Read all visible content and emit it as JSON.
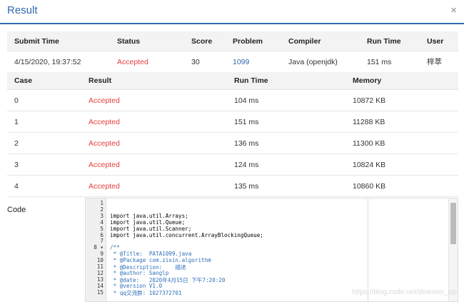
{
  "dialog": {
    "title": "Result",
    "close_icon": "×"
  },
  "submission": {
    "headers": [
      "Submit Time",
      "Status",
      "Score",
      "Problem",
      "Compiler",
      "Run Time",
      "User"
    ],
    "row": {
      "submit_time": "4/15/2020, 19:37:52",
      "status": "Accepted",
      "score": "30",
      "problem": "1099",
      "compiler": "Java (openjdk)",
      "run_time": "151 ms",
      "user": "梓萃"
    },
    "colors": {
      "accepted": "#e53e3e",
      "link": "#2f6ab0"
    }
  },
  "cases": {
    "headers": [
      "Case",
      "Result",
      "Run Time",
      "Memory"
    ],
    "rows": [
      {
        "case": "0",
        "result": "Accepted",
        "run_time": "104 ms",
        "memory": "10872 KB"
      },
      {
        "case": "1",
        "result": "Accepted",
        "run_time": "151 ms",
        "memory": "11288 KB"
      },
      {
        "case": "2",
        "result": "Accepted",
        "run_time": "136 ms",
        "memory": "11300 KB"
      },
      {
        "case": "3",
        "result": "Accepted",
        "run_time": "124 ms",
        "memory": "10824 KB"
      },
      {
        "case": "4",
        "result": "Accepted",
        "run_time": "135 ms",
        "memory": "10860 KB"
      }
    ]
  },
  "code": {
    "label": "Code",
    "lines": [
      {
        "n": "1",
        "t": "",
        "c": ""
      },
      {
        "n": "2",
        "t": "",
        "c": ""
      },
      {
        "n": "3",
        "t": "import java.util.Arrays;",
        "c": ""
      },
      {
        "n": "4",
        "t": "import java.util.Queue;",
        "c": ""
      },
      {
        "n": "5",
        "t": "import java.util.Scanner;",
        "c": ""
      },
      {
        "n": "6",
        "t": "import java.util.concurrent.ArrayBlockingQueue;",
        "c": ""
      },
      {
        "n": "7",
        "t": "",
        "c": ""
      },
      {
        "n": "8",
        "t": "/**",
        "c": "comment"
      },
      {
        "n": "9",
        "t": " * @Title:  PATA1099.java",
        "c": "comment"
      },
      {
        "n": "10",
        "t": " * @Package com.zixin.algorithm",
        "c": "comment"
      },
      {
        "n": "11",
        "t": " * @Description:    描述",
        "c": "comment"
      },
      {
        "n": "12",
        "t": " * @author: Sanglp",
        "c": "comment"
      },
      {
        "n": "13",
        "t": " * @date:   2020年4月15日 下午7:20:20",
        "c": "comment"
      },
      {
        "n": "14",
        "t": " * @version V1.0",
        "c": "comment"
      },
      {
        "n": "15",
        "t": " * qq交流群: 1027372701",
        "c": "comment"
      }
    ],
    "fold_marker": "8 ▾"
  },
  "watermark": "https://blog.csdn.net/deamon_sip"
}
